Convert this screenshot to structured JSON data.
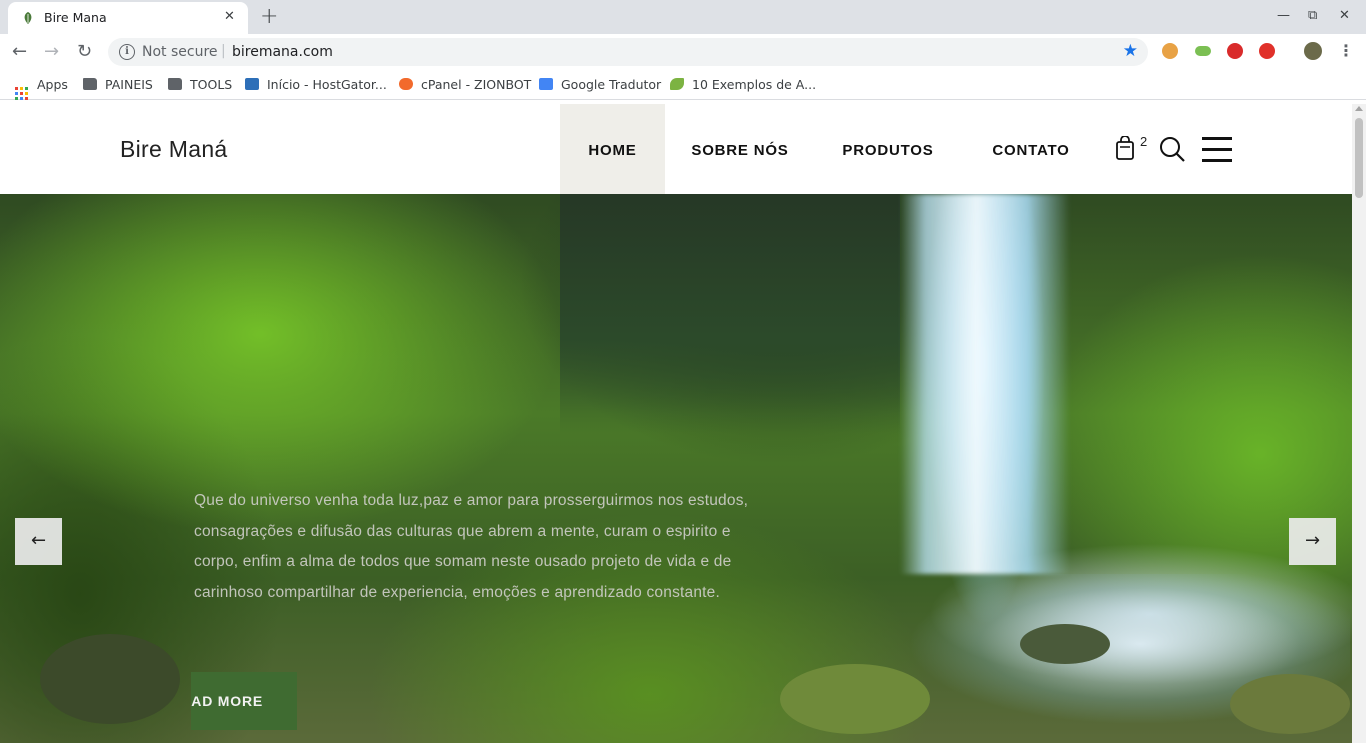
{
  "browser": {
    "tab_title": "Bire Mana",
    "tab_close": "✕",
    "new_tab": "+",
    "window_controls": {
      "minimize": "—",
      "restore": "⧉",
      "close": "✕"
    },
    "nav": {
      "back": "←",
      "forward": "→",
      "reload": "↻"
    },
    "security_label": "Not secure",
    "separator": "|",
    "url": "biremana.com",
    "bookmark_star": "★",
    "menu": "⋮"
  },
  "bookmarks": [
    {
      "label": "Apps",
      "icon": "apps-grid-icon"
    },
    {
      "label": "PAINEIS",
      "icon": "folder-icon"
    },
    {
      "label": "TOOLS",
      "icon": "folder-icon"
    },
    {
      "label": "Início - HostGator...",
      "icon": "hostgator-icon"
    },
    {
      "label": "cPanel - ZIONBOT",
      "icon": "cpanel-icon"
    },
    {
      "label": "Google Tradutor",
      "icon": "google-translate-icon"
    },
    {
      "label": "10 Exemplos de A...",
      "icon": "leaf-icon"
    }
  ],
  "site": {
    "logo": "Bire Maná",
    "menu": [
      {
        "label": "HOME",
        "active": true
      },
      {
        "label": "SOBRE NÓS",
        "active": false
      },
      {
        "label": "PRODUTOS",
        "active": false
      },
      {
        "label": "CONTATO",
        "active": false
      }
    ],
    "cart_count": "2"
  },
  "hero": {
    "text": "Que do universo venha toda luz,paz e amor para prosserguirmos nos estudos, consagrações e difusão das culturas que abrem a mente, curam o espirito e corpo, enfim a alma de todos que somam neste ousado projeto de vida e de carinhoso compartilhar de experiencia, emoções e aprendizado constante.",
    "button": "READ MORE",
    "prev": "←",
    "next": "→"
  },
  "colors": {
    "accent": "#3f6b31",
    "active_menu_bg": "#efeee9",
    "bookmark_star": "#1a73e8"
  }
}
